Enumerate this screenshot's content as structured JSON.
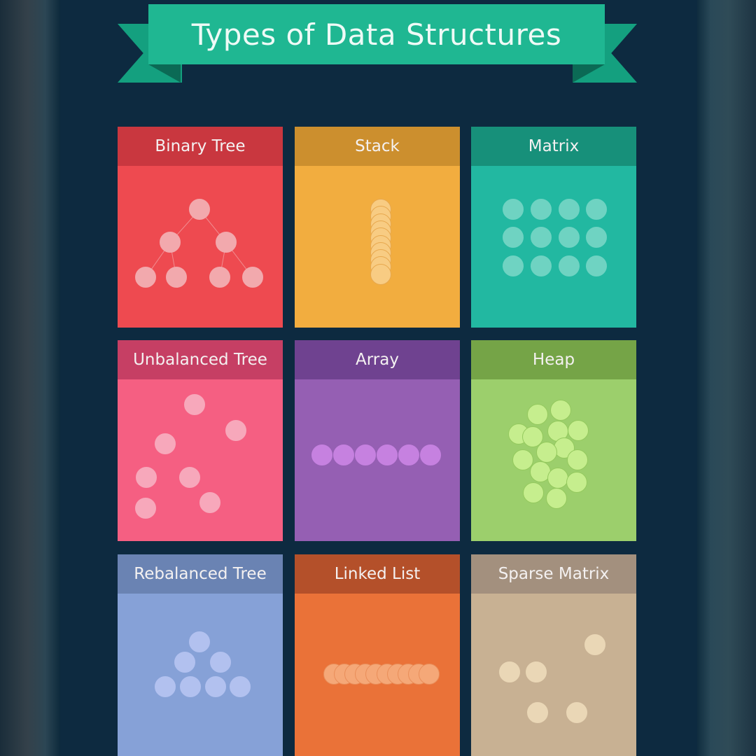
{
  "title": "Types of Data Structures",
  "colors": {
    "background": "#0d2a40",
    "ribbon": "#1fb792"
  },
  "cards": [
    {
      "title": "Binary Tree",
      "header_color": "#c9373f",
      "body_color": "#ee4a50",
      "node_color": "#f2a9ad",
      "node_border": "#f2a9ad"
    },
    {
      "title": "Stack",
      "header_color": "#cc8f2e",
      "body_color": "#f2ad3f",
      "node_color": "#f8cc83",
      "node_border": "#e7a84e"
    },
    {
      "title": "Matrix",
      "header_color": "#17907a",
      "body_color": "#22b8a1",
      "node_color": "#6fd3c2",
      "node_border": "#6fd3c2"
    },
    {
      "title": "Unbalanced Tree",
      "header_color": "#c63f64",
      "body_color": "#f55f82",
      "node_color": "#f7a8bb",
      "node_border": "#f7a8bb"
    },
    {
      "title": "Array",
      "header_color": "#6f4290",
      "body_color": "#955fb3",
      "node_color": "#c681e0",
      "node_border": "#c681e0"
    },
    {
      "title": "Heap",
      "header_color": "#75a447",
      "body_color": "#9ccf6c",
      "node_color": "#c6ee8e",
      "node_border": "#94c95e"
    },
    {
      "title": "Rebalanced Tree",
      "header_color": "#6a83b3",
      "body_color": "#86a1d7",
      "node_color": "#b2c1ef",
      "node_border": "#b2c1ef"
    },
    {
      "title": "Linked List",
      "header_color": "#b4502a",
      "body_color": "#ea7238",
      "node_color": "#f5a878",
      "node_border": "#e98e5a"
    },
    {
      "title": "Sparse Matrix",
      "header_color": "#a3907e",
      "body_color": "#c8b193",
      "node_color": "#ead7b6",
      "node_border": "#ead7b6"
    }
  ]
}
